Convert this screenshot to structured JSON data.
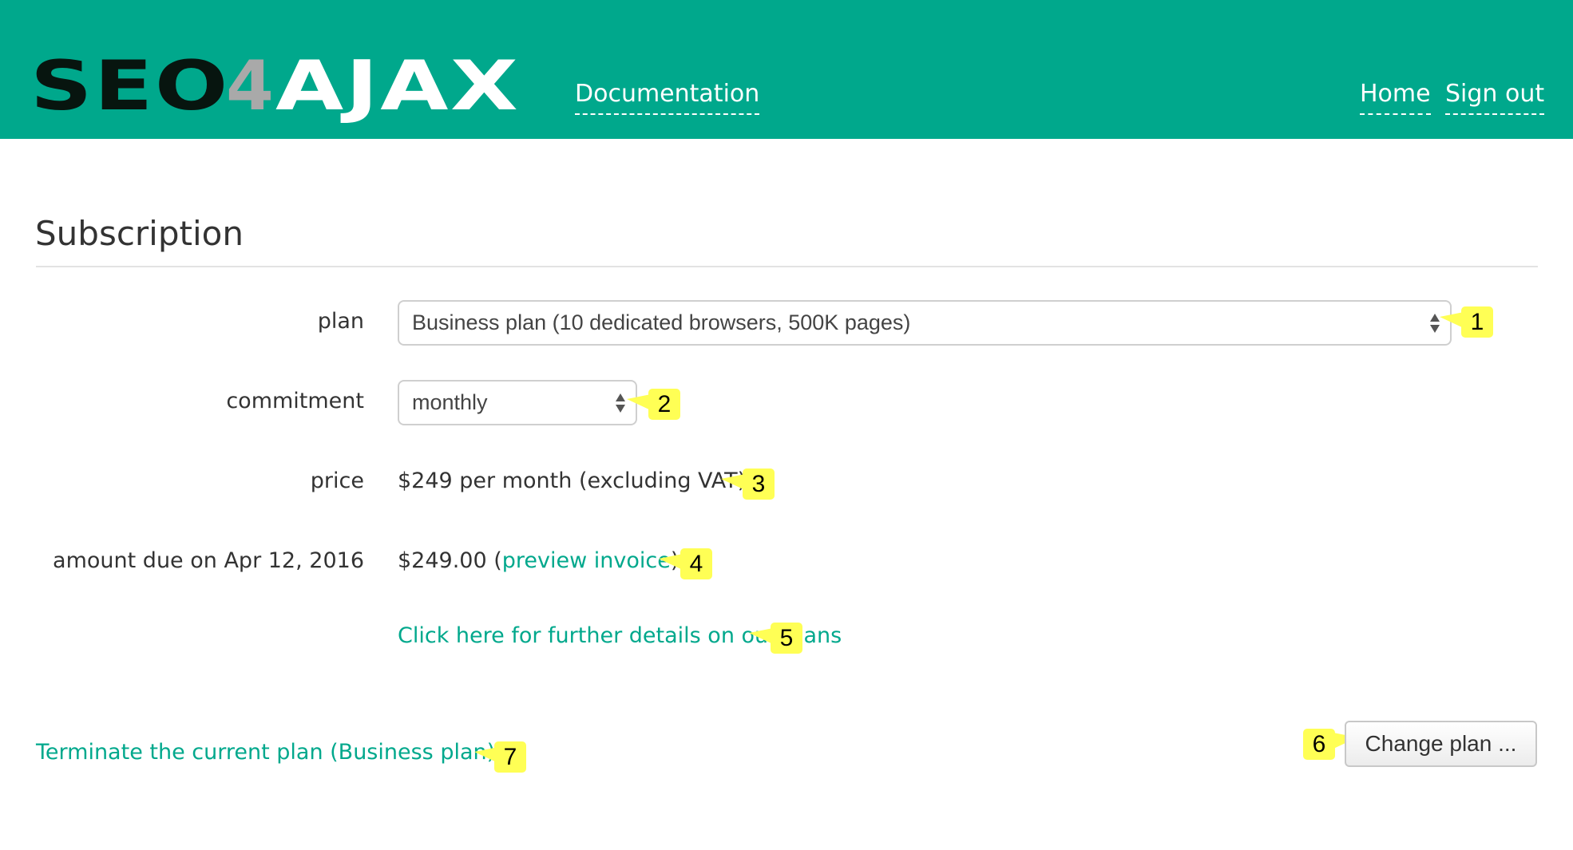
{
  "header": {
    "logo": {
      "part1": "SEO",
      "part2": "4",
      "part3": "AJAX"
    },
    "nav_left": [
      {
        "label": "Documentation"
      }
    ],
    "nav_right": [
      {
        "label": "Home"
      },
      {
        "label": "Sign out"
      }
    ]
  },
  "page": {
    "title": "Subscription"
  },
  "form": {
    "plan": {
      "label": "plan",
      "selected": "Business plan (10 dedicated browsers, 500K pages)"
    },
    "commitment": {
      "label": "commitment",
      "selected": "monthly"
    },
    "price": {
      "label": "price",
      "value": "$249 per month (excluding VAT)"
    },
    "amount_due": {
      "label": "amount due on Apr 12, 2016",
      "value": "$249.00 (",
      "link": "preview invoice",
      "suffix": ")"
    },
    "details_link": "Click here for further details on our plans"
  },
  "actions": {
    "terminate_link": "Terminate the current plan (Business plan)",
    "change_plan_button": "Change plan ..."
  },
  "callouts": [
    "1",
    "2",
    "3",
    "4",
    "5",
    "6",
    "7"
  ],
  "colors": {
    "brand": "#00a88c",
    "callout": "#ffff55"
  }
}
